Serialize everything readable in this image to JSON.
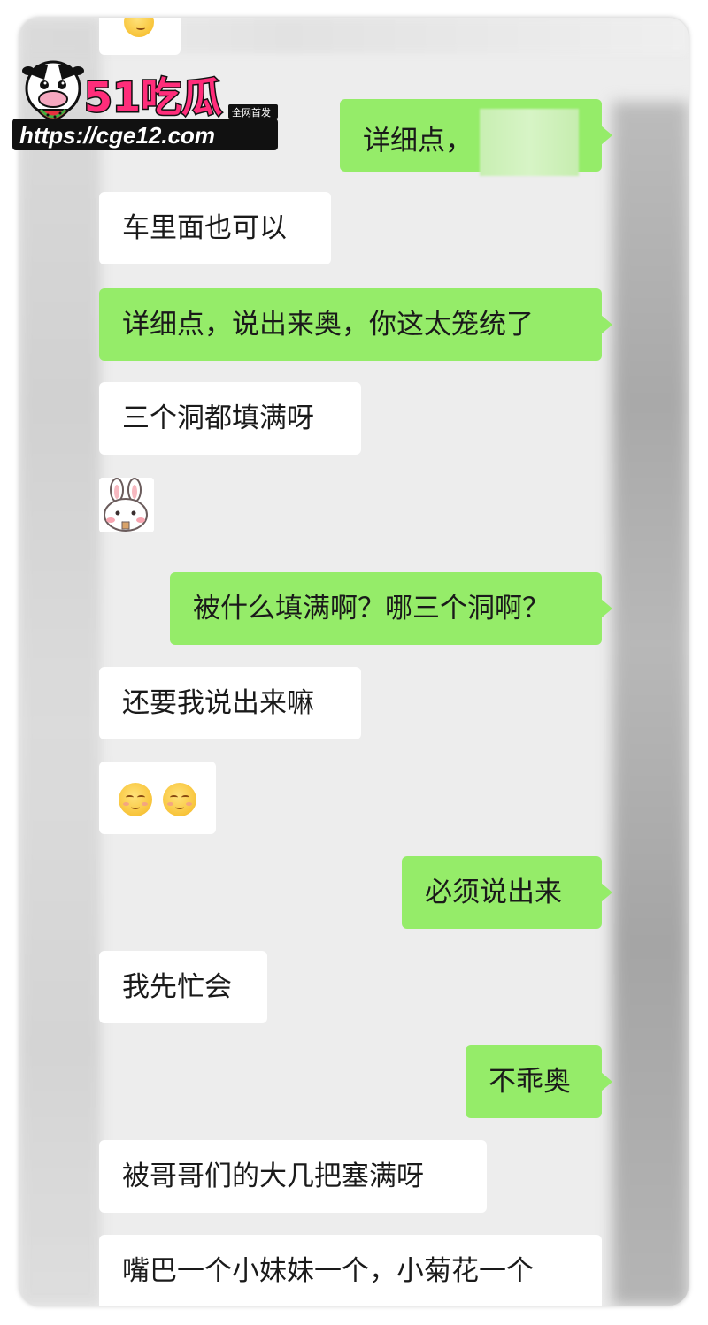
{
  "watermark": {
    "brand_text": "51吃瓜",
    "tag_text": "全网首发",
    "url_text": "https://cge12.com"
  },
  "messages": [
    {
      "side": "out",
      "text": "详细点，",
      "redacted": true
    },
    {
      "side": "in",
      "text": "车里面也可以"
    },
    {
      "side": "out",
      "text": "详细点，说出来奥，你这太笼统了"
    },
    {
      "side": "in",
      "text": "三个洞都填满呀"
    },
    {
      "side": "in",
      "type": "sticker",
      "sticker": "bunny-sticker"
    },
    {
      "side": "out",
      "text": "被什么填满啊？哪三个洞啊？"
    },
    {
      "side": "in",
      "text": "还要我说出来嘛"
    },
    {
      "side": "in",
      "type": "emoji",
      "emoji": [
        "shy-smile-icon",
        "shy-smile-icon"
      ]
    },
    {
      "side": "out",
      "text": "必须说出来"
    },
    {
      "side": "in",
      "text": "我先忙会"
    },
    {
      "side": "out",
      "text": "不乖奥"
    },
    {
      "side": "in",
      "text": "被哥哥们的大几把塞满呀"
    },
    {
      "side": "in",
      "text": "嘴巴一个小妹妹一个，小菊花一个"
    }
  ],
  "colors": {
    "chat_background": "#ededed",
    "outgoing_bubble": "#95ec69",
    "incoming_bubble": "#ffffff",
    "brand_pink": "#ff2d7a"
  }
}
